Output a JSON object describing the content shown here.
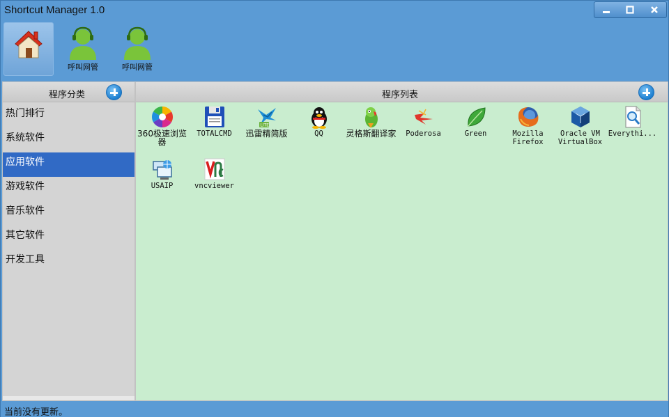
{
  "window": {
    "title": "Shortcut Manager 1.0"
  },
  "toolbar": {
    "buttons": [
      {
        "icon": "home-icon",
        "label": ""
      },
      {
        "icon": "call-agent-icon",
        "label": "呼叫网管"
      },
      {
        "icon": "call-agent-icon",
        "label": "呼叫网管"
      }
    ]
  },
  "left": {
    "header": "程序分类",
    "categories": [
      "热门排行",
      "系统软件",
      "应用软件",
      "游戏软件",
      "音乐软件",
      "其它软件",
      "开发工具"
    ],
    "selected_index": 2
  },
  "right": {
    "header": "程序列表",
    "programs": [
      {
        "label": "360极速浏览器",
        "icon": "browser-360-icon"
      },
      {
        "label": "TOTALCMD",
        "icon": "floppy-disk-icon"
      },
      {
        "label": "迅雷精简版",
        "icon": "thunder-bird-icon"
      },
      {
        "label": "QQ",
        "icon": "penguin-icon"
      },
      {
        "label": "灵格斯翻译家",
        "icon": "parrot-icon"
      },
      {
        "label": "Poderosa",
        "icon": "lightning-icon"
      },
      {
        "label": "Green",
        "icon": "leaf-icon"
      },
      {
        "label": "Mozilla Firefox",
        "icon": "firefox-icon"
      },
      {
        "label": "Oracle VM VirtualBox",
        "icon": "virtualbox-cube-icon"
      },
      {
        "label": "Everythi...",
        "icon": "search-file-icon"
      },
      {
        "label": "USAIP",
        "icon": "network-computer-icon"
      },
      {
        "label": "vncviewer",
        "icon": "vnc-icon"
      }
    ]
  },
  "status": {
    "text": "当前没有更新。"
  },
  "colors": {
    "chrome": "#5b9bd5",
    "list_bg": "#c9edcf",
    "selected": "#316ac5"
  }
}
